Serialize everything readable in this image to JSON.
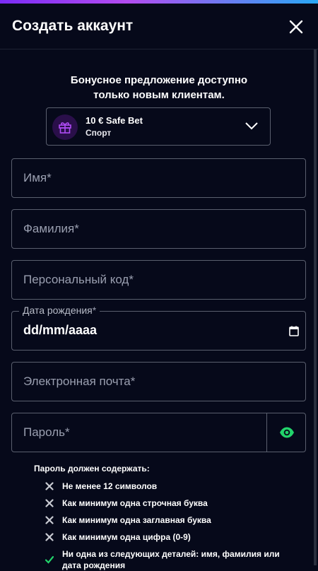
{
  "header": {
    "title": "Создать аккаунт"
  },
  "bonus": {
    "text_line1": "Бонусное предложение доступно",
    "text_line2": "только новым клиентам.",
    "offer_name": "10 € Safe Bet",
    "offer_category": "Спорт"
  },
  "form": {
    "first_name_placeholder": "Имя",
    "last_name_placeholder": "Фамилия",
    "personal_code_placeholder": "Персональный код",
    "birth_date_label": "Дата рождения",
    "birth_date_value": "dd/mm/aaaa",
    "email_placeholder": "Электронная почта",
    "password_placeholder": "Пароль",
    "required_mark": "*"
  },
  "password_rules": {
    "title": "Пароль должен содержать:",
    "items": [
      {
        "text": "Не менее 12 символов",
        "status": "fail"
      },
      {
        "text": "Как минимум одна строчная буква",
        "status": "fail"
      },
      {
        "text": "Как минимум одна заглавная буква",
        "status": "fail"
      },
      {
        "text": "Как минимум одна цифра (0-9)",
        "status": "fail"
      },
      {
        "text": "Ни одна из следующих деталей: имя, фамилия или дата рождения",
        "status": "pass"
      }
    ]
  },
  "colors": {
    "background": "#06091a",
    "accent_green": "#22d46b",
    "fail_mark": "#c9cbd3",
    "gift_purple": "#9b3df0"
  },
  "icons": {
    "close": "close-icon",
    "gift": "gift-icon",
    "chevron": "chevron-down-icon",
    "calendar": "calendar-icon",
    "eye": "eye-icon"
  }
}
